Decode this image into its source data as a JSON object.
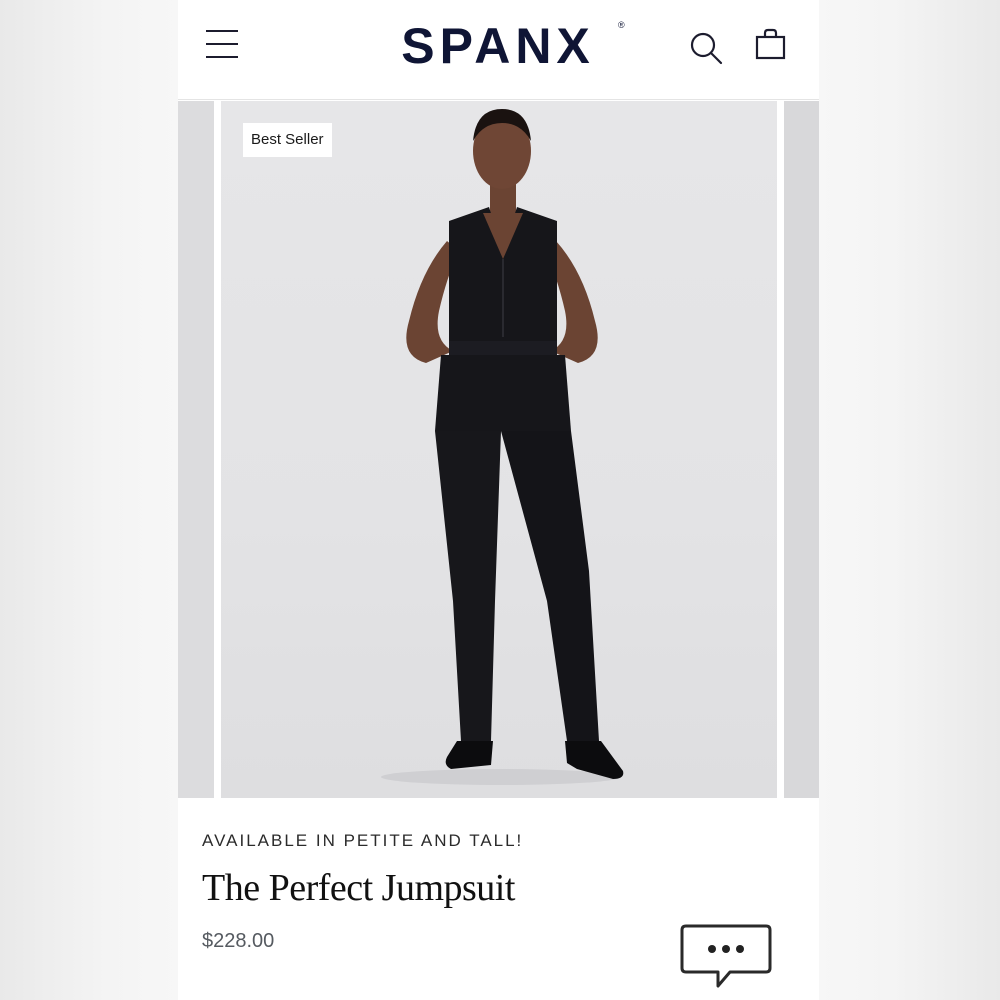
{
  "header": {
    "brand": "SPANX",
    "brand_mark": "®",
    "icons": [
      "menu-icon",
      "search-icon",
      "shopping-bag-icon"
    ]
  },
  "carousel": {
    "badge": "Best Seller"
  },
  "product": {
    "availability": "AVAILABLE IN PETITE AND TALL!",
    "title": "The Perfect Jumpsuit",
    "price": "$228.00"
  },
  "chat": {
    "icon": "chat-bubble-icon"
  },
  "colors": {
    "brand_navy": "#0f1535",
    "background": "#ffffff",
    "photo_backdrop": "#e4e4e6",
    "garment": "#16161a"
  }
}
